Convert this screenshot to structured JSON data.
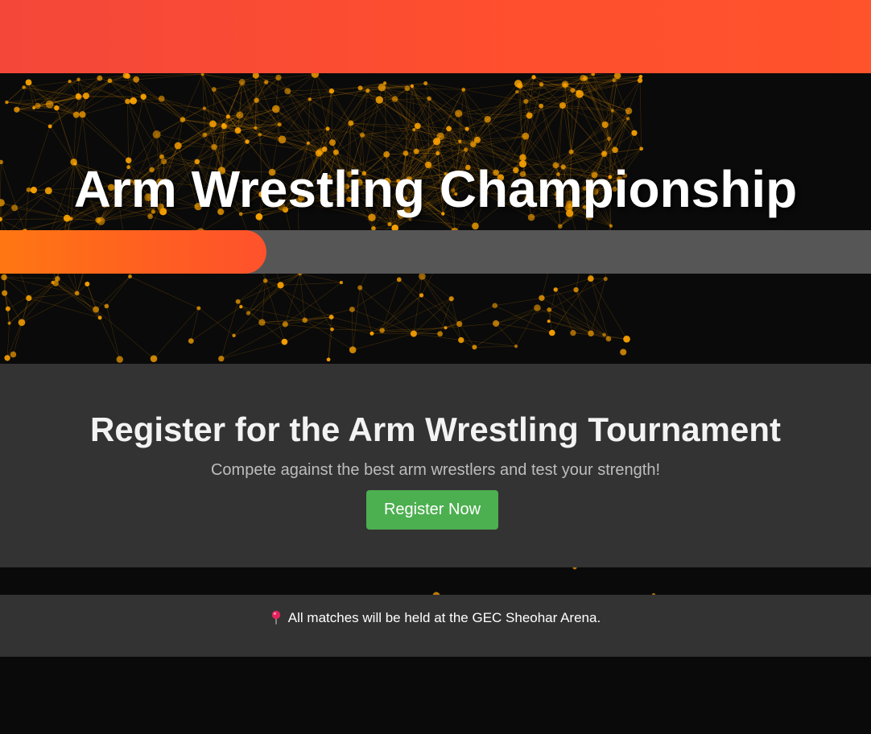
{
  "hero": {
    "title": "Arm Wrestling Championship",
    "progress_fraction": 0.306
  },
  "register": {
    "title": "Register for the Arm Wrestling Tournament",
    "subtitle": "Compete against the best arm wrestlers and test your strength!",
    "button_label": "Register Now"
  },
  "venue": {
    "icon": "map-pin-icon",
    "text": "All matches will be held at the GEC Sheohar Arena."
  },
  "colors": {
    "background": "#0a0a0a",
    "top_bar": "#ff4f2e",
    "particle": "#ffa500",
    "progress_fill": "#ff6a1c",
    "progress_track": "#565656",
    "panel": "#333333",
    "register_button": "#4caf50"
  }
}
